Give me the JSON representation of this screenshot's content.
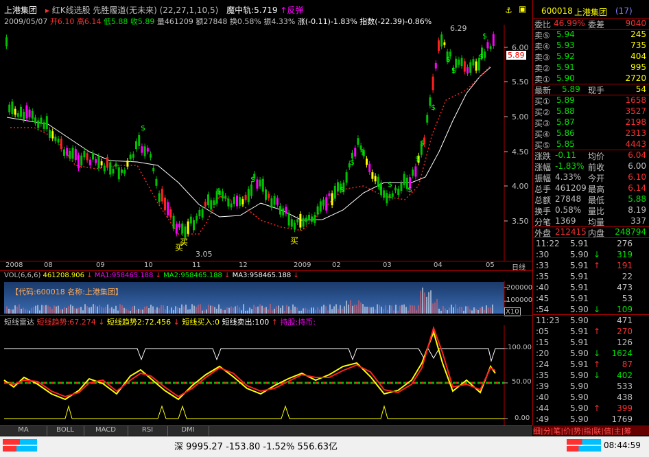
{
  "header": {
    "stock_name": "上港集团",
    "method": "红K线选股",
    "indicator": "先胜履道(无未来)",
    "params": "(22,27,1,10,5)",
    "moon": "魔中轨:5.719",
    "flip": "↑反弹",
    "date": "2009/05/07",
    "open": "开6.10",
    "high": "高6.14",
    "low": "低5.88",
    "close": "收5.89",
    "vol": "量461209",
    "amount": "额27848",
    "turnover": "换0.58%",
    "amplitude": "振4.33%",
    "change": "涨(-0.11)-1.83%",
    "index": "指数(-22.39)-0.86%"
  },
  "price_chart": {
    "y_ticks": [
      "6.00",
      "5.50",
      "5.00",
      "4.50",
      "4.00",
      "3.50"
    ],
    "current_price_tag": "5.89",
    "high_label": "6.29",
    "low_label": "3.05",
    "buy_labels": [
      "买",
      "买",
      "买"
    ],
    "dollar_marks": [
      "$",
      "$",
      "$",
      "$",
      "$",
      "$",
      "$",
      "$",
      "$",
      "$",
      "$",
      "$",
      "$",
      "$",
      "$",
      "$"
    ],
    "x_ticks": [
      "2008",
      "08",
      "09",
      "10",
      "11",
      "12",
      "2009",
      "02",
      "03",
      "04",
      "05"
    ],
    "period": "日线"
  },
  "volume_chart": {
    "title_vol": "VOL(6,6,6)",
    "vol_value": "461208.906",
    "ma1": "MA1:958465.188",
    "ma2": "MA2:958465.188",
    "ma3": "MA3:958465.188",
    "code_label": "【代码:600018 名称:上港集团】",
    "y_ticks": [
      "200000",
      "100000"
    ],
    "multiplier": "X10"
  },
  "oscillator": {
    "name": "短线雷达",
    "trend1": "短线趋势:67.274",
    "trend2": "短线趋势2:72.456",
    "buy_in": "短线买入:0",
    "sell_out": "短线卖出:100",
    "hold": "持股:持币:",
    "y_ticks": [
      "100.00",
      "50.00",
      "0.00"
    ]
  },
  "bottom_tabs": [
    "MA",
    "BOLL",
    "MACD",
    "RSI",
    "DMI"
  ],
  "quote_panel": {
    "code": "600018",
    "name": "上港集团",
    "count": "(17)",
    "wei_bi_label": "委比",
    "wei_bi": "46.99%",
    "wei_cha_label": "委差",
    "wei_cha": "9040",
    "asks": [
      {
        "label": "卖⑤",
        "price": "5.94",
        "vol": "245"
      },
      {
        "label": "卖④",
        "price": "5.93",
        "vol": "735"
      },
      {
        "label": "卖③",
        "price": "5.92",
        "vol": "404"
      },
      {
        "label": "卖②",
        "price": "5.91",
        "vol": "995"
      },
      {
        "label": "卖①",
        "price": "5.90",
        "vol": "2720"
      }
    ],
    "last_label": "最新",
    "last": "5.89",
    "hand_label": "现手",
    "hand": "54",
    "bids": [
      {
        "label": "买①",
        "price": "5.89",
        "vol": "1658"
      },
      {
        "label": "买②",
        "price": "5.88",
        "vol": "3527"
      },
      {
        "label": "买③",
        "price": "5.87",
        "vol": "2198"
      },
      {
        "label": "买④",
        "price": "5.86",
        "vol": "2313"
      },
      {
        "label": "买⑤",
        "price": "5.85",
        "vol": "4443"
      }
    ],
    "stats": [
      {
        "l1": "涨跌",
        "v1": "-0.11",
        "l2": "均价",
        "v2": "6.04"
      },
      {
        "l1": "涨幅",
        "v1": "-1.83%",
        "l2": "前收",
        "v2": "6.00"
      },
      {
        "l1": "振幅",
        "v1": "4.33%",
        "l2": "今开",
        "v2": "6.10"
      },
      {
        "l1": "总手",
        "v1": "461209",
        "l2": "最高",
        "v2": "6.14"
      },
      {
        "l1": "总额",
        "v1": "27848",
        "l2": "最低",
        "v2": "5.88"
      },
      {
        "l1": "换手",
        "v1": "0.58%",
        "l2": "量比",
        "v2": "8.19"
      },
      {
        "l1": "分笔",
        "v1": "1369",
        "l2": "均量",
        "v2": "337"
      }
    ],
    "outer_label": "外盘",
    "outer": "212415",
    "inner_label": "内盘",
    "inner": "248794",
    "ticks_a": [
      {
        "t": "11:22",
        "p": "5.91",
        "d": "",
        "v": "276"
      },
      {
        "t": ":30",
        "p": "5.90",
        "d": "↓",
        "v": "319"
      },
      {
        "t": ":33",
        "p": "5.91",
        "d": "↑",
        "v": "191"
      },
      {
        "t": ":35",
        "p": "5.91",
        "d": "",
        "v": "22"
      },
      {
        "t": ":40",
        "p": "5.91",
        "d": "",
        "v": "473"
      },
      {
        "t": ":45",
        "p": "5.91",
        "d": "",
        "v": "53"
      },
      {
        "t": ":54",
        "p": "5.90",
        "d": "↓",
        "v": "109"
      }
    ],
    "ticks_b": [
      {
        "t": "11:23",
        "p": "5.90",
        "d": "",
        "v": "471"
      },
      {
        "t": ":05",
        "p": "5.91",
        "d": "↑",
        "v": "270"
      },
      {
        "t": ":15",
        "p": "5.91",
        "d": "",
        "v": "126"
      },
      {
        "t": ":20",
        "p": "5.90",
        "d": "↓",
        "v": "1624"
      },
      {
        "t": ":24",
        "p": "5.91",
        "d": "↑",
        "v": "87"
      },
      {
        "t": ":35",
        "p": "5.90",
        "d": "↓",
        "v": "402"
      },
      {
        "t": ":39",
        "p": "5.90",
        "d": "",
        "v": "533"
      },
      {
        "t": ":40",
        "p": "5.90",
        "d": "",
        "v": "438"
      },
      {
        "t": ":44",
        "p": "5.90",
        "d": "↑",
        "v": "399"
      },
      {
        "t": ":49",
        "p": "5.90",
        "d": "",
        "v": "1769"
      }
    ],
    "footer_tabs": "细|分|笔|价|势|指|联|值|主|筹"
  },
  "status_bar": {
    "exchange": "深",
    "index_value": "9995.27",
    "index_change": "-153.80",
    "index_pct": "-1.52%",
    "amount": "556.63亿",
    "time": "08:44:59"
  }
}
